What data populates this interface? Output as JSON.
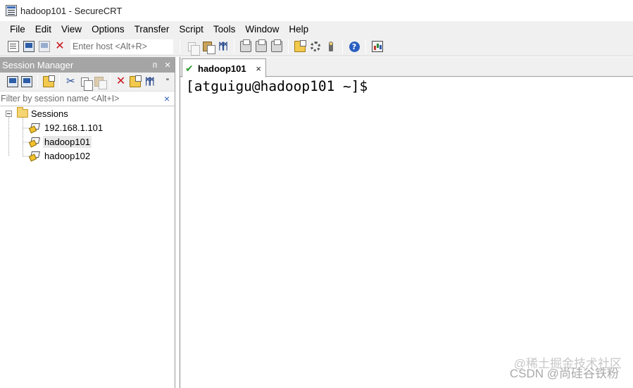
{
  "window": {
    "title": "hadoop101 - SecureCRT"
  },
  "menubar": {
    "items": [
      "File",
      "Edit",
      "View",
      "Options",
      "Transfer",
      "Script",
      "Tools",
      "Window",
      "Help"
    ]
  },
  "toolbar": {
    "host_placeholder": "Enter host <Alt+R>",
    "icons_left": [
      "connect-icon",
      "quick-connect-icon",
      "connect-in-tab-icon",
      "disconnect-icon"
    ],
    "icons_right": [
      "copy-icon",
      "paste-icon",
      "find-icon",
      "print-icon",
      "print-selection-icon",
      "print-screen-icon",
      "session-options-icon",
      "global-options-icon",
      "keymap-icon",
      "help-icon",
      "sftp-icon"
    ]
  },
  "session_manager": {
    "title": "Session Manager",
    "pin_glyph": "ᴨ",
    "close_glyph": "×",
    "more_glyph": "”",
    "filter_placeholder": "Filter by session name <Alt+I>",
    "filter_clear": "×",
    "tree": {
      "root": "Sessions",
      "sessions": [
        "192.168.1.101",
        "hadoop101",
        "hadoop102"
      ],
      "selected": "hadoop101"
    }
  },
  "tabs": [
    {
      "label": "hadoop101",
      "status": "connected",
      "close": "×"
    }
  ],
  "terminal": {
    "lines": [
      "[atguigu@hadoop101 ~]$"
    ]
  },
  "watermark": {
    "line1": "@稀土掘金技术社区",
    "line2": "CSDN @尚硅谷铁粉"
  },
  "colors": {
    "panel_header": "#a5a5a5",
    "toolbar_bg": "#f0f0f0",
    "tab_check": "#2d9a2d",
    "disconnect_red": "#c8141b"
  }
}
